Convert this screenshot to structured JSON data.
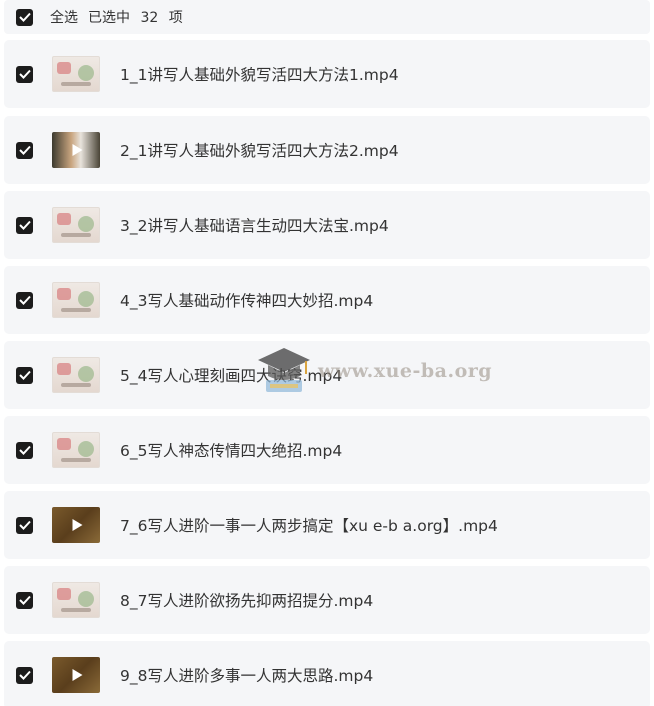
{
  "header": {
    "select_all_label": "全选",
    "selected_prefix": "已选中",
    "selected_count": "32",
    "selected_suffix": "项"
  },
  "files": [
    {
      "name": "1_1讲写人基础外貌写活四大方法1.mp4",
      "thumbnail": "slide",
      "checked": true
    },
    {
      "name": "2_1讲写人基础外貌写活四大方法2.mp4",
      "thumbnail": "photo",
      "checked": true
    },
    {
      "name": "3_2讲写人基础语言生动四大法宝.mp4",
      "thumbnail": "slide",
      "checked": true
    },
    {
      "name": "4_3写人基础动作传神四大妙招.mp4",
      "thumbnail": "slide",
      "checked": true
    },
    {
      "name": "5_4写人心理刻画四大诀窍.mp4",
      "thumbnail": "slide",
      "checked": true
    },
    {
      "name": "6_5写人神态传情四大绝招.mp4",
      "thumbnail": "slide",
      "checked": true
    },
    {
      "name": "7_6写人进阶一事一人两步搞定【xu e-b a.org】.mp4",
      "thumbnail": "video",
      "checked": true
    },
    {
      "name": "8_7写人进阶欲扬先抑两招提分.mp4",
      "thumbnail": "slide",
      "checked": true
    },
    {
      "name": "9_8写人进阶多事一人两大思路.mp4",
      "thumbnail": "video",
      "checked": true
    }
  ],
  "watermark": {
    "text": "www.xue-ba.org",
    "icon": "graduation-cap-icon"
  },
  "colors": {
    "row_background": "#f5f6f8",
    "checkbox": "#1c1c1c",
    "text": "#333333"
  }
}
